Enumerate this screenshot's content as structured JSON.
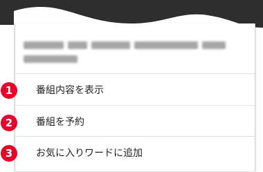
{
  "colors": {
    "header_dark": "#2e2e2e",
    "badge_red": "#e6002a",
    "divider": "#e2e2e2",
    "text": "#222222"
  },
  "menu": {
    "items": [
      {
        "badge": "1",
        "label": "番組内容を表示"
      },
      {
        "badge": "2",
        "label": "番組を予約"
      },
      {
        "badge": "3",
        "label": "お気に入りワードに追加"
      }
    ]
  }
}
